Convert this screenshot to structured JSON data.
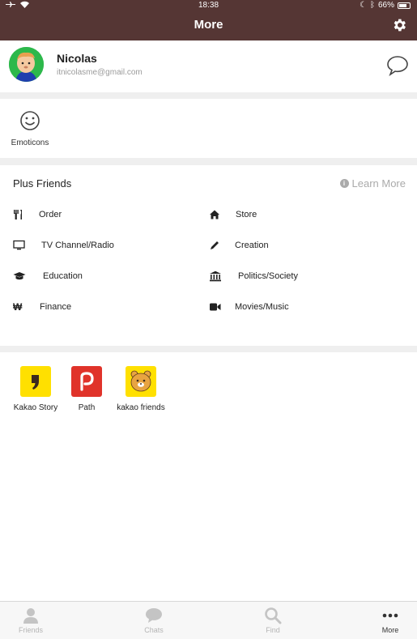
{
  "status": {
    "time": "18:38",
    "battery": "66%"
  },
  "header": {
    "title": "More"
  },
  "profile": {
    "name": "Nicolas",
    "email": "itnicolasme@gmail.com"
  },
  "emoticons": {
    "label": "Emoticons"
  },
  "plus_friends": {
    "title": "Plus Friends",
    "learn_more": "Learn More",
    "categories": [
      {
        "label": "Order",
        "icon": "cutlery-icon"
      },
      {
        "label": "Store",
        "icon": "home-icon"
      },
      {
        "label": "TV Channel/Radio",
        "icon": "monitor-icon"
      },
      {
        "label": "Creation",
        "icon": "pencil-icon"
      },
      {
        "label": "Education",
        "icon": "graduation-cap-icon"
      },
      {
        "label": "Politics/Society",
        "icon": "institution-icon"
      },
      {
        "label": "Finance",
        "icon": "won-icon"
      },
      {
        "label": "Movies/Music",
        "icon": "video-camera-icon"
      }
    ]
  },
  "apps": [
    {
      "label": "Kakao Story",
      "color": "#ffe000"
    },
    {
      "label": "Path",
      "color": "#e0332a"
    },
    {
      "label": "kakao friends",
      "color": "#ffe000"
    }
  ],
  "tabs": [
    {
      "label": "Friends"
    },
    {
      "label": "Chats"
    },
    {
      "label": "Find"
    },
    {
      "label": "More"
    }
  ],
  "colors": {
    "header_bg": "#553634",
    "divider": "#efefef"
  }
}
